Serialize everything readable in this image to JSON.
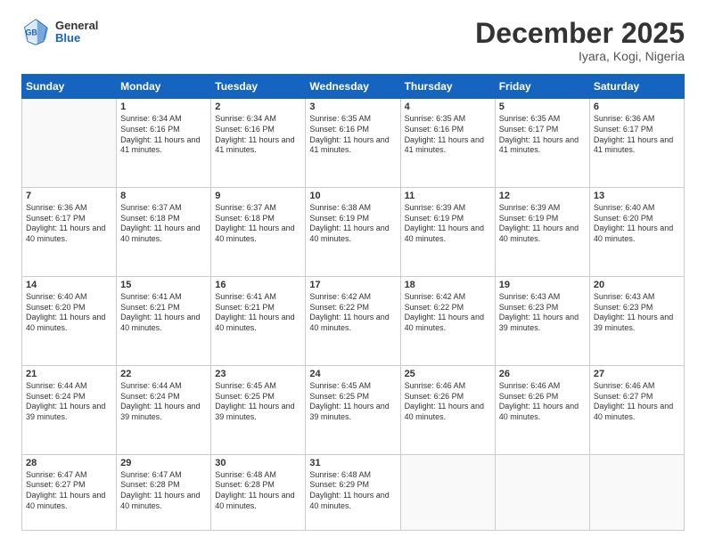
{
  "header": {
    "logo": {
      "general": "General",
      "blue": "Blue"
    },
    "month": "December 2025",
    "location": "Iyara, Kogi, Nigeria"
  },
  "days": [
    "Sunday",
    "Monday",
    "Tuesday",
    "Wednesday",
    "Thursday",
    "Friday",
    "Saturday"
  ],
  "weeks": [
    [
      {
        "day": "",
        "sunrise": "",
        "sunset": "",
        "daylight": ""
      },
      {
        "day": "1",
        "sunrise": "Sunrise: 6:34 AM",
        "sunset": "Sunset: 6:16 PM",
        "daylight": "Daylight: 11 hours and 41 minutes."
      },
      {
        "day": "2",
        "sunrise": "Sunrise: 6:34 AM",
        "sunset": "Sunset: 6:16 PM",
        "daylight": "Daylight: 11 hours and 41 minutes."
      },
      {
        "day": "3",
        "sunrise": "Sunrise: 6:35 AM",
        "sunset": "Sunset: 6:16 PM",
        "daylight": "Daylight: 11 hours and 41 minutes."
      },
      {
        "day": "4",
        "sunrise": "Sunrise: 6:35 AM",
        "sunset": "Sunset: 6:16 PM",
        "daylight": "Daylight: 11 hours and 41 minutes."
      },
      {
        "day": "5",
        "sunrise": "Sunrise: 6:35 AM",
        "sunset": "Sunset: 6:17 PM",
        "daylight": "Daylight: 11 hours and 41 minutes."
      },
      {
        "day": "6",
        "sunrise": "Sunrise: 6:36 AM",
        "sunset": "Sunset: 6:17 PM",
        "daylight": "Daylight: 11 hours and 41 minutes."
      }
    ],
    [
      {
        "day": "7",
        "sunrise": "Sunrise: 6:36 AM",
        "sunset": "Sunset: 6:17 PM",
        "daylight": "Daylight: 11 hours and 40 minutes."
      },
      {
        "day": "8",
        "sunrise": "Sunrise: 6:37 AM",
        "sunset": "Sunset: 6:18 PM",
        "daylight": "Daylight: 11 hours and 40 minutes."
      },
      {
        "day": "9",
        "sunrise": "Sunrise: 6:37 AM",
        "sunset": "Sunset: 6:18 PM",
        "daylight": "Daylight: 11 hours and 40 minutes."
      },
      {
        "day": "10",
        "sunrise": "Sunrise: 6:38 AM",
        "sunset": "Sunset: 6:19 PM",
        "daylight": "Daylight: 11 hours and 40 minutes."
      },
      {
        "day": "11",
        "sunrise": "Sunrise: 6:39 AM",
        "sunset": "Sunset: 6:19 PM",
        "daylight": "Daylight: 11 hours and 40 minutes."
      },
      {
        "day": "12",
        "sunrise": "Sunrise: 6:39 AM",
        "sunset": "Sunset: 6:19 PM",
        "daylight": "Daylight: 11 hours and 40 minutes."
      },
      {
        "day": "13",
        "sunrise": "Sunrise: 6:40 AM",
        "sunset": "Sunset: 6:20 PM",
        "daylight": "Daylight: 11 hours and 40 minutes."
      }
    ],
    [
      {
        "day": "14",
        "sunrise": "Sunrise: 6:40 AM",
        "sunset": "Sunset: 6:20 PM",
        "daylight": "Daylight: 11 hours and 40 minutes."
      },
      {
        "day": "15",
        "sunrise": "Sunrise: 6:41 AM",
        "sunset": "Sunset: 6:21 PM",
        "daylight": "Daylight: 11 hours and 40 minutes."
      },
      {
        "day": "16",
        "sunrise": "Sunrise: 6:41 AM",
        "sunset": "Sunset: 6:21 PM",
        "daylight": "Daylight: 11 hours and 40 minutes."
      },
      {
        "day": "17",
        "sunrise": "Sunrise: 6:42 AM",
        "sunset": "Sunset: 6:22 PM",
        "daylight": "Daylight: 11 hours and 40 minutes."
      },
      {
        "day": "18",
        "sunrise": "Sunrise: 6:42 AM",
        "sunset": "Sunset: 6:22 PM",
        "daylight": "Daylight: 11 hours and 40 minutes."
      },
      {
        "day": "19",
        "sunrise": "Sunrise: 6:43 AM",
        "sunset": "Sunset: 6:23 PM",
        "daylight": "Daylight: 11 hours and 39 minutes."
      },
      {
        "day": "20",
        "sunrise": "Sunrise: 6:43 AM",
        "sunset": "Sunset: 6:23 PM",
        "daylight": "Daylight: 11 hours and 39 minutes."
      }
    ],
    [
      {
        "day": "21",
        "sunrise": "Sunrise: 6:44 AM",
        "sunset": "Sunset: 6:24 PM",
        "daylight": "Daylight: 11 hours and 39 minutes."
      },
      {
        "day": "22",
        "sunrise": "Sunrise: 6:44 AM",
        "sunset": "Sunset: 6:24 PM",
        "daylight": "Daylight: 11 hours and 39 minutes."
      },
      {
        "day": "23",
        "sunrise": "Sunrise: 6:45 AM",
        "sunset": "Sunset: 6:25 PM",
        "daylight": "Daylight: 11 hours and 39 minutes."
      },
      {
        "day": "24",
        "sunrise": "Sunrise: 6:45 AM",
        "sunset": "Sunset: 6:25 PM",
        "daylight": "Daylight: 11 hours and 39 minutes."
      },
      {
        "day": "25",
        "sunrise": "Sunrise: 6:46 AM",
        "sunset": "Sunset: 6:26 PM",
        "daylight": "Daylight: 11 hours and 40 minutes."
      },
      {
        "day": "26",
        "sunrise": "Sunrise: 6:46 AM",
        "sunset": "Sunset: 6:26 PM",
        "daylight": "Daylight: 11 hours and 40 minutes."
      },
      {
        "day": "27",
        "sunrise": "Sunrise: 6:46 AM",
        "sunset": "Sunset: 6:27 PM",
        "daylight": "Daylight: 11 hours and 40 minutes."
      }
    ],
    [
      {
        "day": "28",
        "sunrise": "Sunrise: 6:47 AM",
        "sunset": "Sunset: 6:27 PM",
        "daylight": "Daylight: 11 hours and 40 minutes."
      },
      {
        "day": "29",
        "sunrise": "Sunrise: 6:47 AM",
        "sunset": "Sunset: 6:28 PM",
        "daylight": "Daylight: 11 hours and 40 minutes."
      },
      {
        "day": "30",
        "sunrise": "Sunrise: 6:48 AM",
        "sunset": "Sunset: 6:28 PM",
        "daylight": "Daylight: 11 hours and 40 minutes."
      },
      {
        "day": "31",
        "sunrise": "Sunrise: 6:48 AM",
        "sunset": "Sunset: 6:29 PM",
        "daylight": "Daylight: 11 hours and 40 minutes."
      },
      {
        "day": "",
        "sunrise": "",
        "sunset": "",
        "daylight": ""
      },
      {
        "day": "",
        "sunrise": "",
        "sunset": "",
        "daylight": ""
      },
      {
        "day": "",
        "sunrise": "",
        "sunset": "",
        "daylight": ""
      }
    ]
  ]
}
